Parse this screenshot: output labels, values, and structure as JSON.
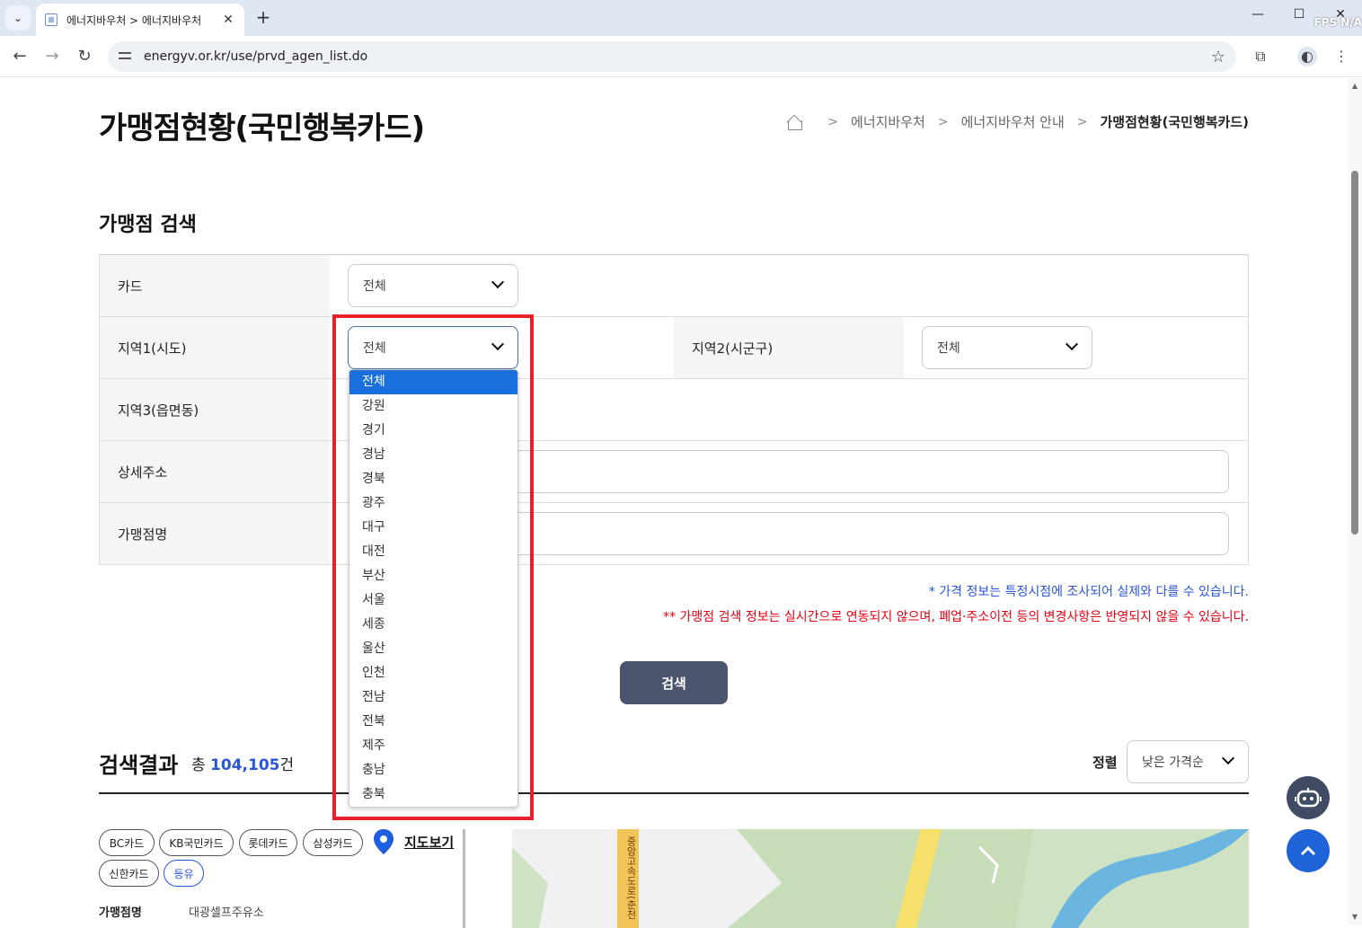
{
  "browser": {
    "tab_title": "에너지바우처 > 에너지바우처",
    "url": "energyv.or.kr/use/prvd_agen_list.do",
    "fps_label": "FPS N/A"
  },
  "page": {
    "title": "가맹점현황(국민행복카드)",
    "breadcrumb": [
      "에너지바우처",
      "에너지바우처 안내",
      "가맹점현황(국민행복카드)"
    ],
    "search_section_title": "가맹점 검색",
    "fields": {
      "card_label": "카드",
      "card_value": "전체",
      "region1_label": "지역1(시도)",
      "region1_value": "전체",
      "region2_label": "지역2(시군구)",
      "region2_value": "전체",
      "region3_label": "지역3(읍면동)",
      "address_label": "상세주소",
      "store_name_label": "가맹점명"
    },
    "notes": {
      "price": "* 가격 정보는 특정시점에 조사되어 실제와 다를 수 있습니다.",
      "realtime": "** 가맹점 검색 정보는 실시간으로 연동되지 않으며, 폐업·주소이전 등의 변경사항은 반영되지 않을 수 있습니다."
    },
    "search_button": "검색",
    "results": {
      "title": "검색결과",
      "count_prefix": "총 ",
      "count": "104,105",
      "count_suffix": "건",
      "sort_label": "정렬",
      "sort_value": "낮은 가격순"
    },
    "chips": [
      "BC카드",
      "KB국민카드",
      "롯데카드",
      "삼성카드",
      "신한카드",
      "등유"
    ],
    "map_link": "지도보기",
    "first_item": {
      "label": "가맹점명",
      "value": "대광셀프주유소"
    },
    "map_road_label": "중앙고속도로(춘천"
  },
  "dropdown": {
    "options": [
      "전체",
      "강원",
      "경기",
      "경남",
      "경북",
      "광주",
      "대구",
      "대전",
      "부산",
      "서울",
      "세종",
      "울산",
      "인천",
      "전남",
      "전북",
      "제주",
      "충남",
      "충북"
    ],
    "selected_index": 0
  },
  "colors": {
    "accent_blue": "#2a55d6",
    "warning_red": "#e60012",
    "highlight_red": "#e8202a",
    "button_dark": "#4b556d"
  }
}
